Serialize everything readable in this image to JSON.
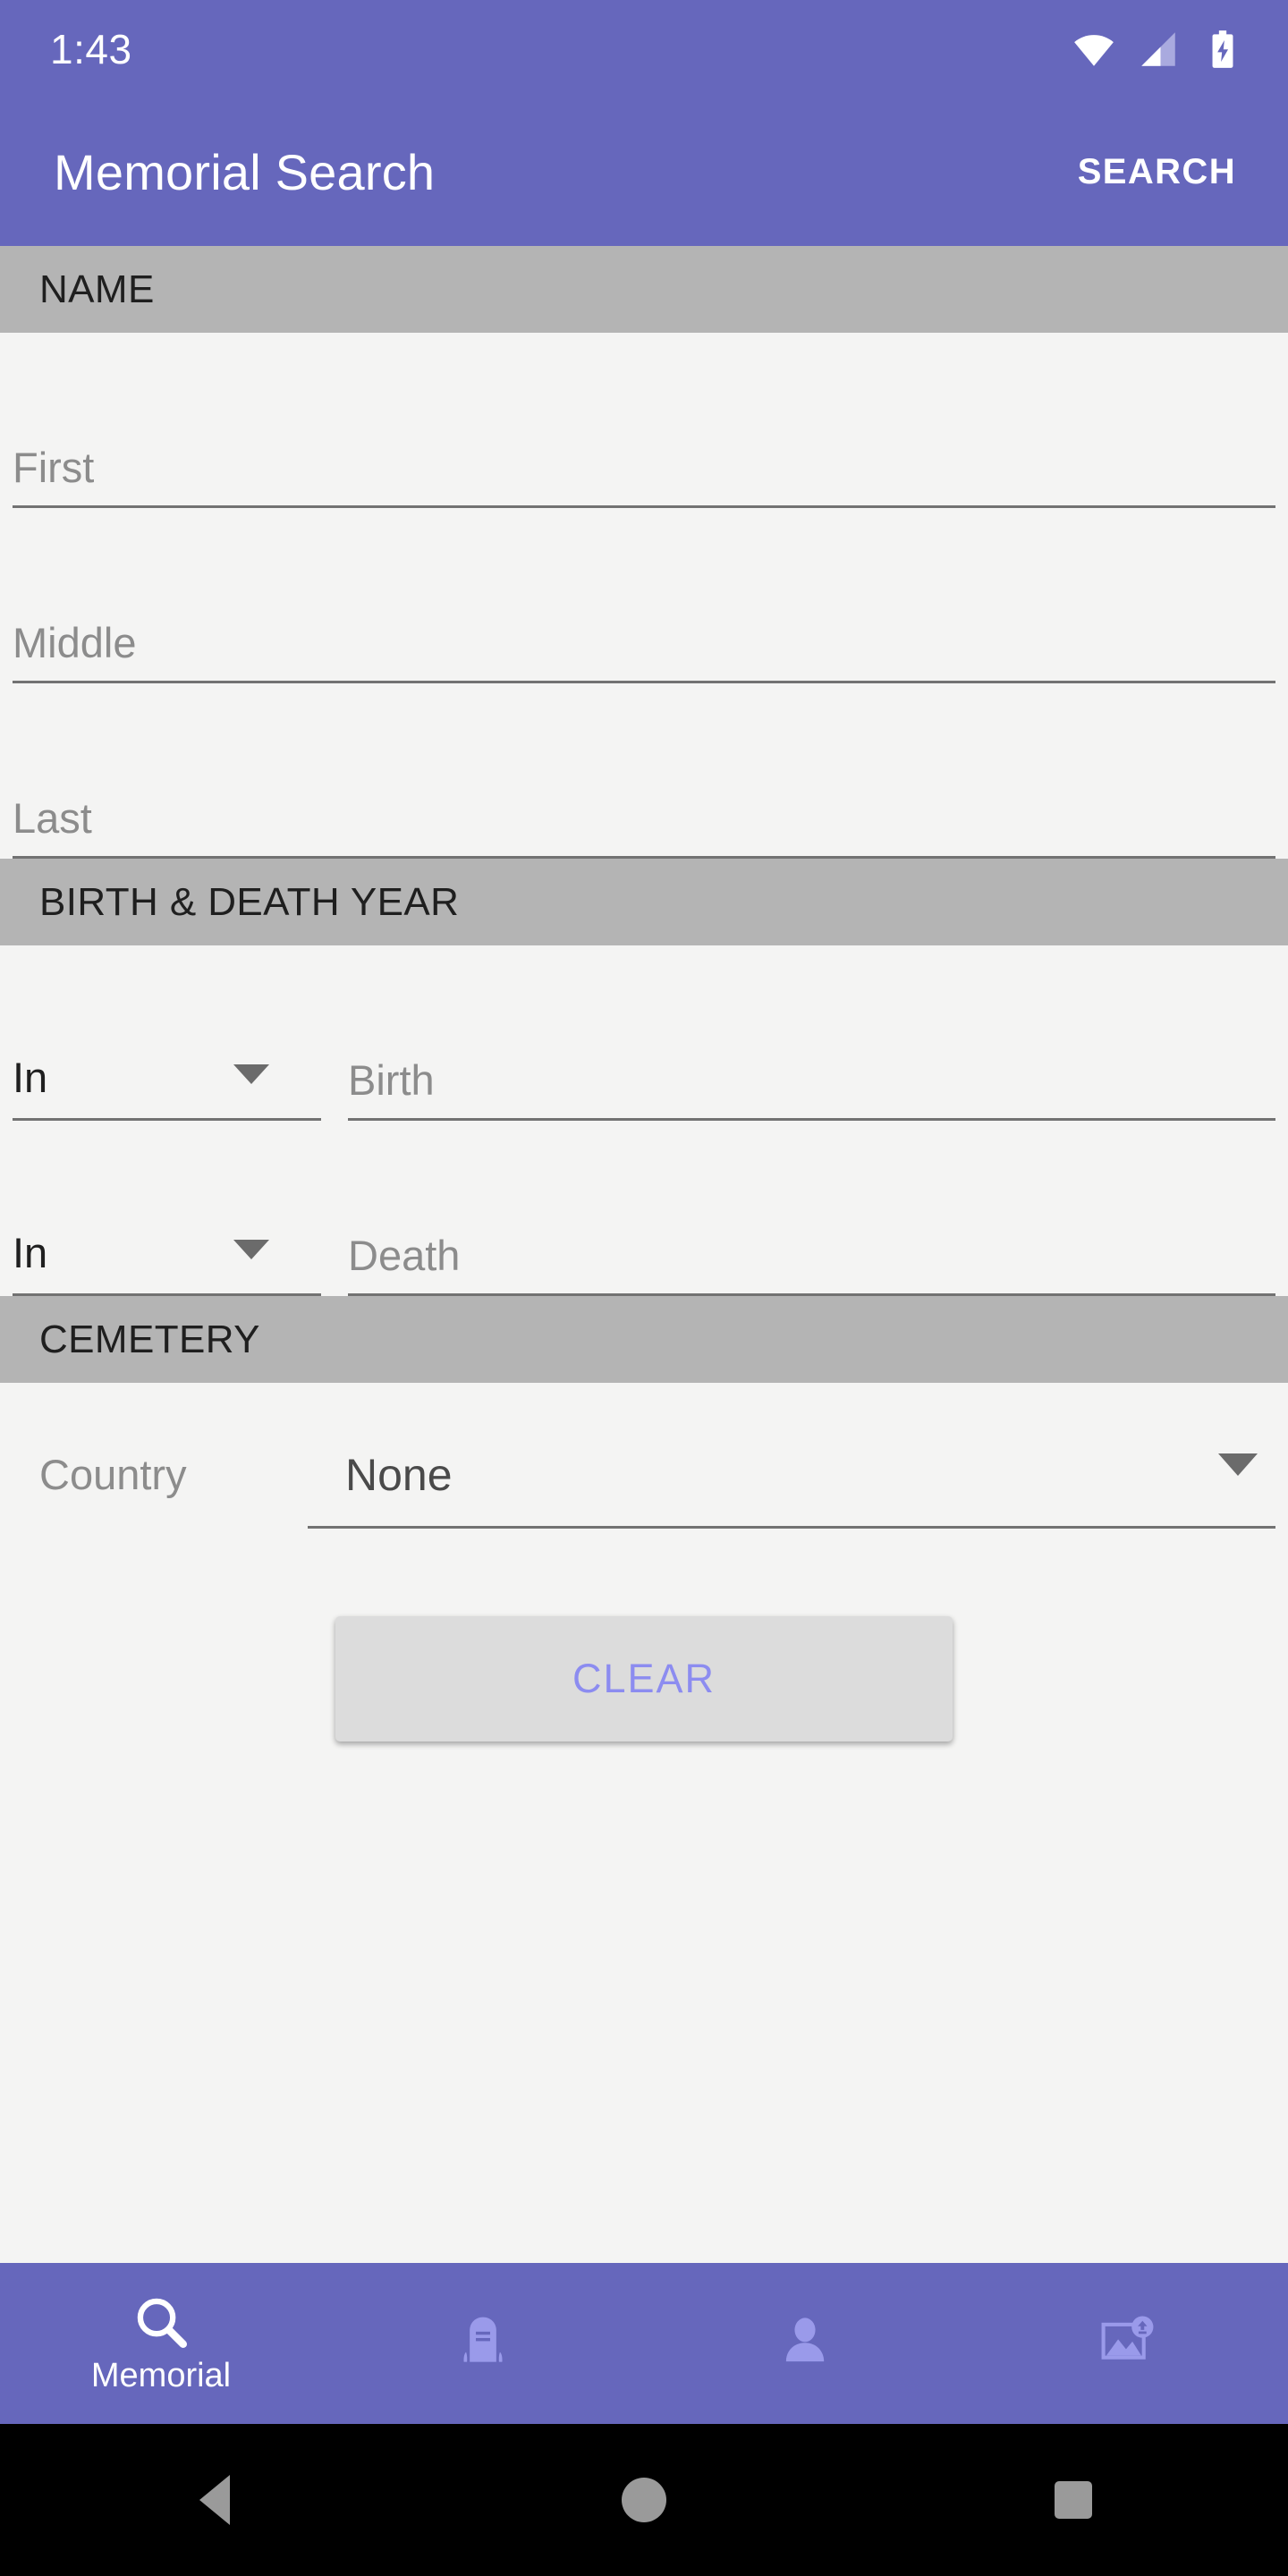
{
  "status_bar": {
    "time": "1:43",
    "icons": [
      "wifi-icon",
      "cellular-signal-icon",
      "battery-charging-icon"
    ]
  },
  "app_bar": {
    "title": "Memorial Search",
    "action_label": "SEARCH"
  },
  "sections": {
    "name": {
      "header": "NAME",
      "fields": [
        {
          "name": "first",
          "placeholder": "First",
          "value": ""
        },
        {
          "name": "middle",
          "placeholder": "Middle",
          "value": ""
        },
        {
          "name": "last",
          "placeholder": "Last",
          "value": ""
        }
      ]
    },
    "years": {
      "header": "BIRTH & DEATH YEAR",
      "rows": [
        {
          "qualifier": "In",
          "placeholder": "Birth",
          "value": ""
        },
        {
          "qualifier": "In",
          "placeholder": "Death",
          "value": ""
        }
      ]
    },
    "cemetery": {
      "header": "CEMETERY",
      "country_label": "Country",
      "country_value": "None"
    }
  },
  "actions": {
    "clear_label": "CLEAR"
  },
  "bottom_nav": [
    {
      "icon": "search-icon",
      "label": "Memorial",
      "active": true
    },
    {
      "icon": "gravestone-icon",
      "label": "",
      "active": false
    },
    {
      "icon": "person-icon",
      "label": "",
      "active": false
    },
    {
      "icon": "photo-upload-icon",
      "label": "",
      "active": false
    }
  ],
  "system_nav": [
    {
      "icon": "back-icon"
    },
    {
      "icon": "home-icon"
    },
    {
      "icon": "recents-icon"
    }
  ],
  "colors": {
    "primary": "#6667BC",
    "section_header_bg": "#B4B4B4",
    "page_bg": "#F4F4F3",
    "accent_text": "#8C8CF0",
    "button_bg": "#DCDCDC",
    "nav_inactive": "#9A9AEA"
  }
}
